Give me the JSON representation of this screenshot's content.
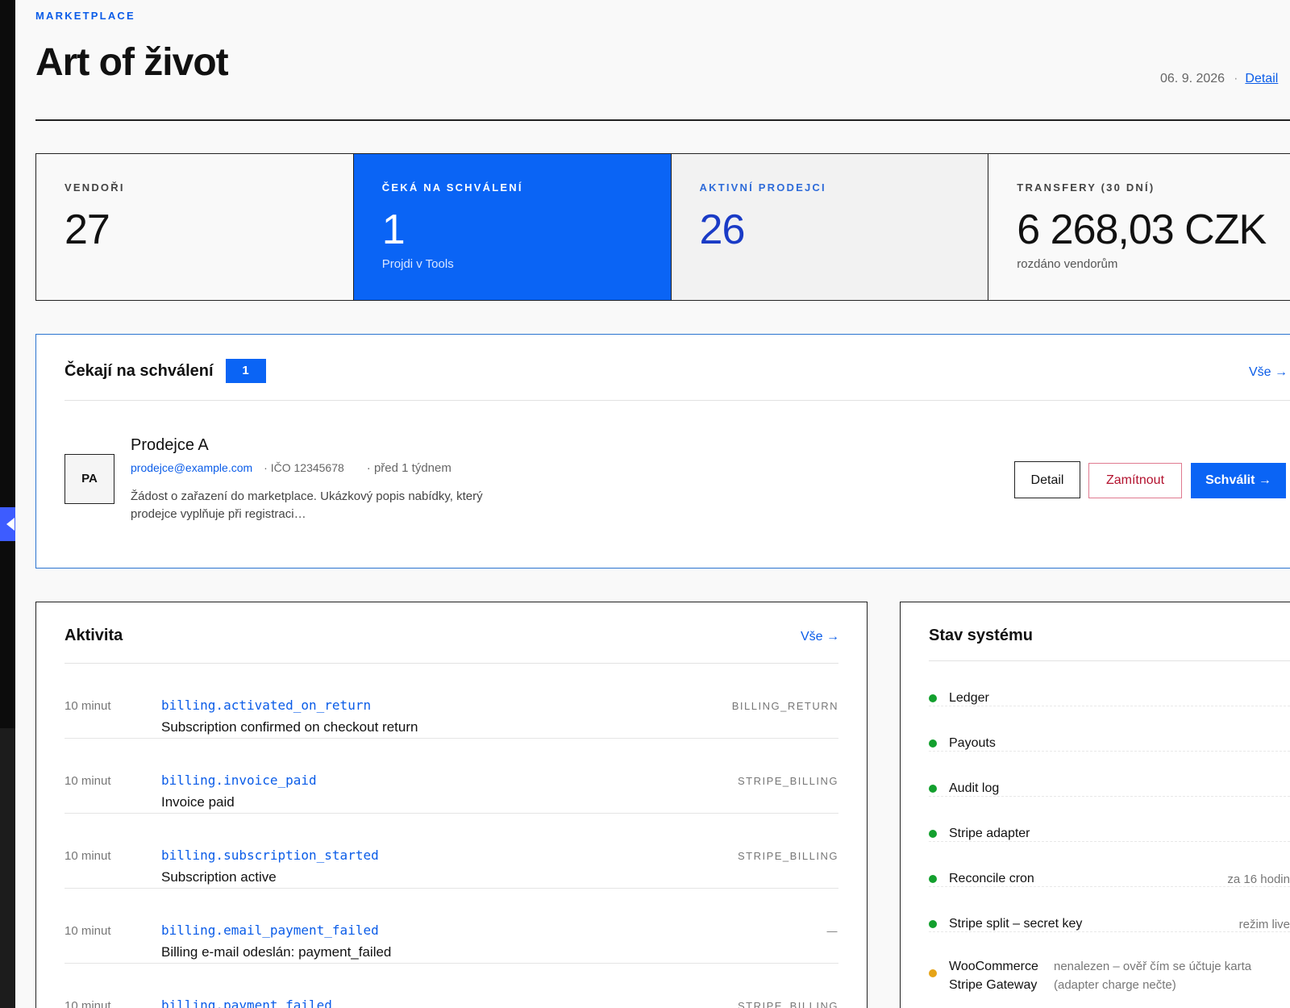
{
  "header": {
    "eyebrow": "MARKETPLACE",
    "title": "Art of život",
    "date": "06. 9. 2026",
    "separator": "·",
    "detail_link": "Detail"
  },
  "stats": [
    {
      "label": "VENDOŘI",
      "value": "27",
      "sub": ""
    },
    {
      "label": "ČEKÁ NA SCHVÁLENÍ",
      "value": "1",
      "sub": "Projdi v Tools"
    },
    {
      "label": "AKTIVNÍ PRODEJCI",
      "value": "26",
      "sub": ""
    },
    {
      "label": "TRANSFERY (30 DNÍ)",
      "value": "6 268,03 CZK",
      "sub": "rozdáno vendorům"
    }
  ],
  "pending": {
    "title": "Čekají na schválení",
    "count": "1",
    "see_all": "Vše →",
    "vendor": {
      "initials": "PA",
      "name": "Prodejce A",
      "email": "prodejce@example.com",
      "ico": "· IČO 12345678",
      "when": "· před 1 týdnem",
      "description": "Žádost o zařazení do marketplace. Ukázkový popis nabídky, který prodejce vyplňuje při registraci…"
    },
    "buttons": {
      "detail": "Detail",
      "reject": "Zamítnout",
      "approve": "Schválit →"
    }
  },
  "activity": {
    "title": "Aktivita",
    "see_all": "Vše →",
    "items": [
      {
        "time": "10 minut",
        "code": "billing.activated_on_return",
        "desc": "Subscription confirmed on checkout return",
        "tag": "BILLING_RETURN"
      },
      {
        "time": "10 minut",
        "code": "billing.invoice_paid",
        "desc": "Invoice paid",
        "tag": "STRIPE_BILLING"
      },
      {
        "time": "10 minut",
        "code": "billing.subscription_started",
        "desc": "Subscription active",
        "tag": "STRIPE_BILLING"
      },
      {
        "time": "10 minut",
        "code": "billing.email_payment_failed",
        "desc": "Billing e-mail odeslán: payment_failed",
        "tag": "—"
      },
      {
        "time": "10 minut",
        "code": "billing.payment_failed",
        "desc": "",
        "tag": "STRIPE_BILLING"
      }
    ]
  },
  "system": {
    "title": "Stav systému",
    "items": [
      {
        "name": "Ledger",
        "note": "",
        "status": "ok"
      },
      {
        "name": "Payouts",
        "note": "",
        "status": "ok"
      },
      {
        "name": "Audit log",
        "note": "",
        "status": "ok"
      },
      {
        "name": "Stripe adapter",
        "note": "",
        "status": "ok"
      },
      {
        "name": "Reconcile cron",
        "note": "za 16 hodin",
        "status": "ok"
      },
      {
        "name": "Stripe split – secret key",
        "note": "režim live",
        "status": "ok"
      },
      {
        "name": "WooCommerce Stripe Gateway",
        "note": "nenalezen – ověř čím se účtuje karta (adapter charge nečte)",
        "status": "warn"
      }
    ]
  },
  "colors": {
    "accent": "#0a64f5",
    "ok": "#13a02e",
    "warn": "#e6a417",
    "danger": "#b3122e"
  }
}
